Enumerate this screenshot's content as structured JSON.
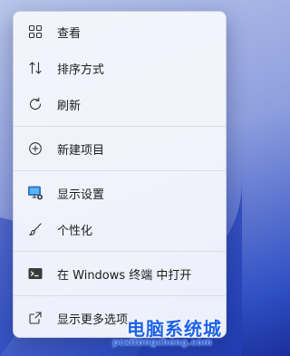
{
  "menu": {
    "items": [
      {
        "label": "查看",
        "icon": "grid-icon"
      },
      {
        "label": "排序方式",
        "icon": "sort-icon"
      },
      {
        "label": "刷新",
        "icon": "refresh-icon"
      },
      {
        "label": "新建项目",
        "icon": "add-circle-icon"
      },
      {
        "label": "显示设置",
        "icon": "monitor-icon"
      },
      {
        "label": "个性化",
        "icon": "brush-icon"
      },
      {
        "label": "在 Windows 终端 中打开",
        "icon": "terminal-icon"
      },
      {
        "label": "显示更多选项",
        "icon": "open-external-icon"
      }
    ]
  },
  "watermark": {
    "text": "电脑系统城",
    "url": "pcxitongcheng.com"
  }
}
